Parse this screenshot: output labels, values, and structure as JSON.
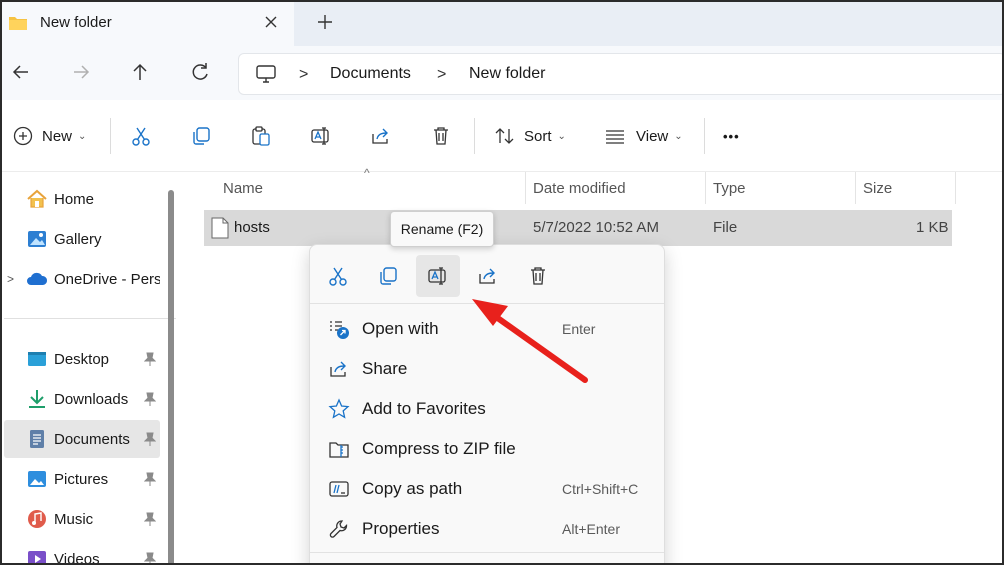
{
  "window": {
    "tab_title": "New folder"
  },
  "address": {
    "crumbs": [
      "Documents",
      "New folder"
    ],
    "separator": ">"
  },
  "toolbar": {
    "new_label": "New",
    "sort_label": "Sort",
    "view_label": "View",
    "more_label": "•••",
    "caret": "⌄"
  },
  "sidebar": {
    "items": [
      {
        "label": "Home",
        "icon": "home-icon"
      },
      {
        "label": "Gallery",
        "icon": "gallery-icon"
      },
      {
        "label": "OneDrive - Perso",
        "icon": "cloud-icon"
      },
      {
        "label": "Desktop",
        "icon": "desktop-icon"
      },
      {
        "label": "Downloads",
        "icon": "download-icon"
      },
      {
        "label": "Documents",
        "icon": "documents-icon"
      },
      {
        "label": "Pictures",
        "icon": "pictures-icon"
      },
      {
        "label": "Music",
        "icon": "music-icon"
      },
      {
        "label": "Videos",
        "icon": "videos-icon"
      }
    ],
    "chevron": ">"
  },
  "files": {
    "columns": [
      "Name",
      "Date modified",
      "Type",
      "Size"
    ],
    "rows": [
      {
        "name": "hosts",
        "date": "5/7/2022 10:52 AM",
        "type": "File",
        "size": "1 KB"
      }
    ]
  },
  "tooltip": {
    "text": "Rename (F2)"
  },
  "context_menu": {
    "items": [
      {
        "label": "Open with",
        "shortcut": "Enter",
        "icon": "open-with-icon"
      },
      {
        "label": "Share",
        "shortcut": "",
        "icon": "share-icon"
      },
      {
        "label": "Add to Favorites",
        "shortcut": "",
        "icon": "star-icon"
      },
      {
        "label": "Compress to ZIP file",
        "shortcut": "",
        "icon": "zip-icon"
      },
      {
        "label": "Copy as path",
        "shortcut": "Ctrl+Shift+C",
        "icon": "copy-path-icon"
      },
      {
        "label": "Properties",
        "shortcut": "Alt+Enter",
        "icon": "wrench-icon"
      }
    ]
  },
  "colors": {
    "accent": "#1a73c8",
    "folder": "#f6c343",
    "annotation_arrow": "#e8211c",
    "selection": "#d9d9d9"
  }
}
